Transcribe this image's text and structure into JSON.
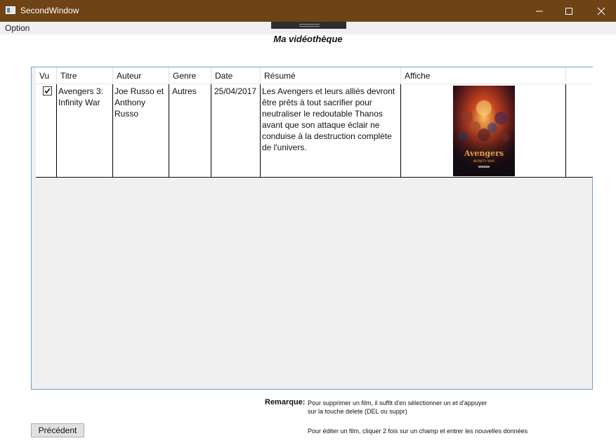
{
  "window": {
    "title": "SecondWindow",
    "accent_color": "#6e4316"
  },
  "menu": {
    "option_label": "Option"
  },
  "heading": "Ma vidéothèque",
  "table": {
    "columns": [
      "Vu",
      "Titre",
      "Auteur",
      "Genre",
      "Date",
      "Résumé",
      "Affiche"
    ],
    "rows": [
      {
        "vu": true,
        "titre": "Avengers 3: Infinity War",
        "auteur": "Joe Russo et Anthony Russo",
        "genre": "Autres",
        "date": "25/04/2017",
        "resume": "Les Avengers et leurs alliés devront être prêts à tout sacrifier pour neutraliser le redoutable Thanos avant que son attaque éclair ne conduise à la destruction complète de l'univers.",
        "affiche_icon": "movie-poster-image",
        "affiche_text": [
          "Avengers",
          "INFINITY WAR"
        ]
      }
    ]
  },
  "remark": {
    "label": "Remarque:",
    "line1": "Pour supprimer un film, il suffit d'en sélectionner un et d'appuyer",
    "line2": "sur la touche delete (DEL ou suppr)",
    "line3": "Pour éditer un film, cliquer 2 fois sur un champ et entrer les nouvelles données"
  },
  "buttons": {
    "previous_label": "Précédent"
  }
}
